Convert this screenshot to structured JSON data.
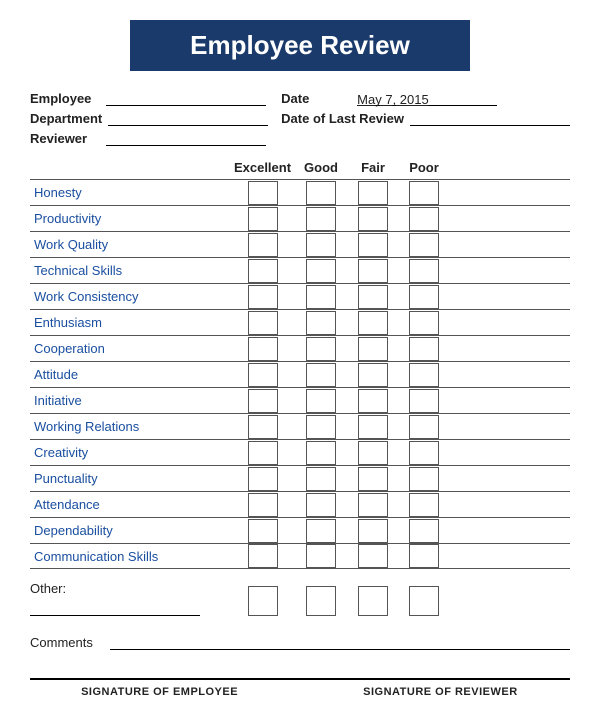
{
  "header": {
    "title": "Employee Review"
  },
  "info": {
    "employee_label": "Employee",
    "department_label": "Department",
    "reviewer_label": "Reviewer",
    "date_label": "Date",
    "date_value": "May 7, 2015",
    "date_of_last_review_label": "Date of Last Review"
  },
  "columns": {
    "excellent": "Excellent",
    "good": "Good",
    "fair": "Fair",
    "poor": "Poor"
  },
  "criteria": [
    {
      "label": "Honesty"
    },
    {
      "label": "Productivity"
    },
    {
      "label": "Work Quality"
    },
    {
      "label": "Technical Skills"
    },
    {
      "label": "Work Consistency"
    },
    {
      "label": "Enthusiasm"
    },
    {
      "label": "Cooperation"
    },
    {
      "label": "Attitude"
    },
    {
      "label": "Initiative"
    },
    {
      "label": "Working Relations"
    },
    {
      "label": "Creativity"
    },
    {
      "label": "Punctuality"
    },
    {
      "label": "Attendance"
    },
    {
      "label": "Dependability"
    },
    {
      "label": "Communication Skills"
    }
  ],
  "other": {
    "label": "Other:"
  },
  "comments": {
    "label": "Comments"
  },
  "signatures": {
    "employee": "SIGNATURE OF EMPLOYEE",
    "reviewer": "SIGNATURE OF REVIEWER"
  }
}
